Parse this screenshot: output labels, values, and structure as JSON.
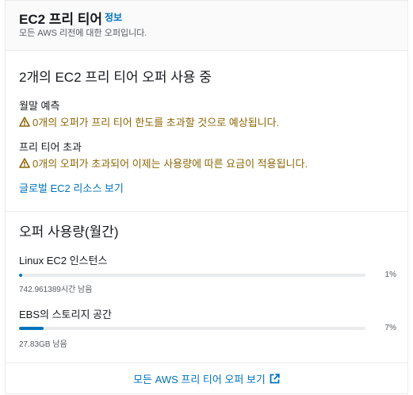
{
  "header": {
    "title": "EC2 프리 티어",
    "info_link": "정보",
    "subtitle": "모든 AWS 리전에 대한 오퍼입니다."
  },
  "offers_section": {
    "title": "2개의 EC2 프리 티어 오퍼 사용 중",
    "monthly_forecast_label": "월말 예측",
    "monthly_forecast_warning": "0개의 오퍼가 프리 티어 한도를 초과할 것으로 예상됩니다.",
    "exceeded_label": "프리 티어 초과",
    "exceeded_warning": "0개의 오퍼가 초과되어 이제는 사용량에 따른 요금이 적용됩니다.",
    "global_link": "글로벌 EC2 리소스 보기"
  },
  "usage_section": {
    "title": "오퍼 사용량(월간)",
    "items": [
      {
        "name": "Linux EC2 인스턴스",
        "percent_label": "1%",
        "percent": 1,
        "remaining": "742.961389시간 남음"
      },
      {
        "name": "EBS의 스토리지 공간",
        "percent_label": "7%",
        "percent": 7,
        "remaining": "27.83GB 남음"
      }
    ]
  },
  "footer": {
    "link": "모든 AWS 프리 티어 오퍼 보기",
    "icon": "external-link-icon"
  },
  "colors": {
    "link": "#0073bb",
    "warning": "#8d6605",
    "progress": "#0073bb"
  }
}
